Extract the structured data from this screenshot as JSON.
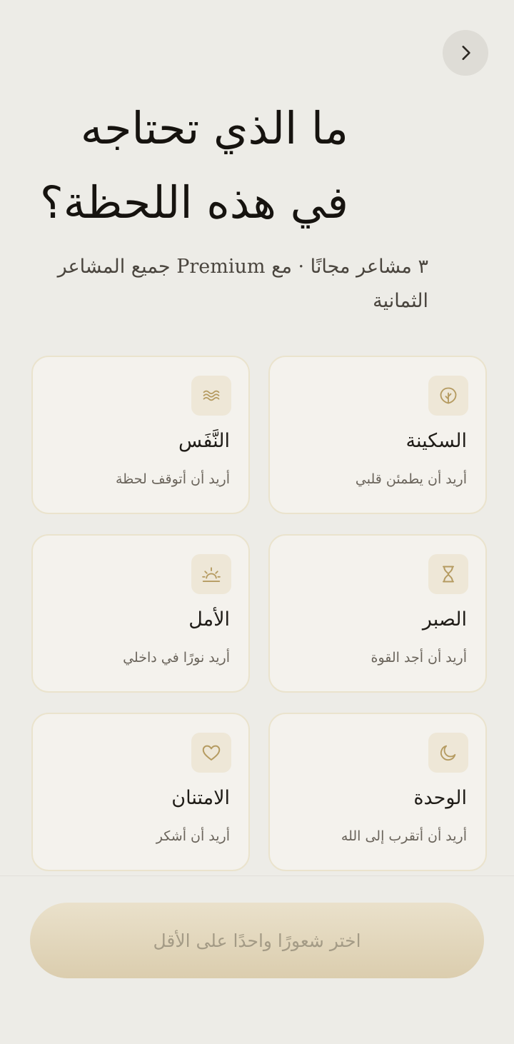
{
  "header": {
    "nav_icon": "chevron-right-icon",
    "title": "ما الذي تحتاجه في هذه اللحظة؟",
    "subtitle": "٣ مشاعر مجانًا · مع Premium جميع المشاعر الثمانية"
  },
  "feelings": [
    {
      "title": "السكينة",
      "subtitle": "أريد أن يطمئن قلبي",
      "icon": "leaf-icon"
    },
    {
      "title": "النَّفَس",
      "subtitle": "أريد أن أتوقف لحظة",
      "icon": "wind-icon"
    },
    {
      "title": "الصبر",
      "subtitle": "أريد أن أجد القوة",
      "icon": "hourglass-icon"
    },
    {
      "title": "الأمل",
      "subtitle": "أريد نورًا في داخلي",
      "icon": "sunrise-icon"
    },
    {
      "title": "الوحدة",
      "subtitle": "أريد أن أتقرب إلى الله",
      "icon": "moon-icon"
    },
    {
      "title": "الامتنان",
      "subtitle": "أريد أن أشكر",
      "icon": "heart-icon"
    }
  ],
  "cta": {
    "label": "اختر شعورًا واحدًا على الأقل"
  },
  "colors": {
    "background": "#EDECE7",
    "card": "#F4F2ED",
    "card_border": "#EAE3CD",
    "icon_tile": "#EEE7D7",
    "accent": "#B59B61",
    "cta_gradient_top": "#EAE1CB",
    "cta_gradient_bottom": "#DBCDAE"
  }
}
